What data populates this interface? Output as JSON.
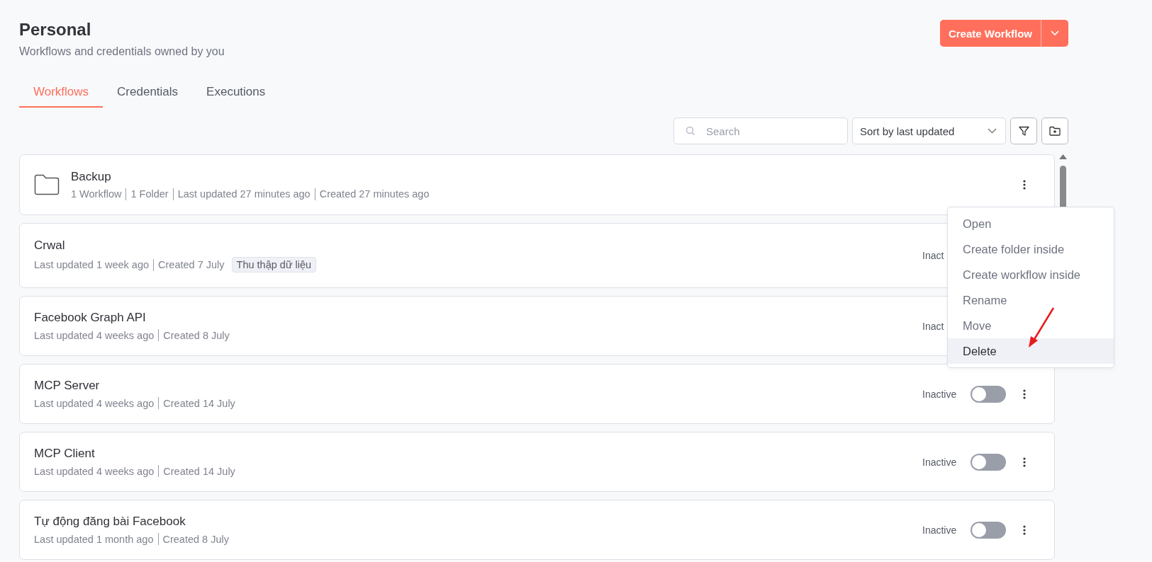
{
  "header": {
    "title": "Personal",
    "subtitle": "Workflows and credentials owned by you",
    "create_button": "Create Workflow"
  },
  "tabs": [
    {
      "label": "Workflows",
      "selected": true
    },
    {
      "label": "Credentials",
      "selected": false
    },
    {
      "label": "Executions",
      "selected": false
    }
  ],
  "search": {
    "placeholder": "Search"
  },
  "sort": {
    "value": "Sort by last updated"
  },
  "items": [
    {
      "kind": "folder",
      "name": "Backup",
      "meta": [
        "1 Workflow",
        "1 Folder",
        "Last updated 27 minutes ago",
        "Created 27 minutes ago"
      ]
    },
    {
      "kind": "workflow",
      "name": "Crwal",
      "meta": [
        "Last updated 1 week ago",
        "Created 7 July"
      ],
      "tags": [
        "Thu thập dữ liệu"
      ],
      "status": "Inact"
    },
    {
      "kind": "workflow",
      "name": "Facebook Graph API",
      "meta": [
        "Last updated 4 weeks ago",
        "Created 8 July"
      ],
      "status": "Inact"
    },
    {
      "kind": "workflow",
      "name": "MCP Server",
      "meta": [
        "Last updated 4 weeks ago",
        "Created 14 July"
      ],
      "status": "Inactive",
      "active": false
    },
    {
      "kind": "workflow",
      "name": "MCP Client",
      "meta": [
        "Last updated 4 weeks ago",
        "Created 14 July"
      ],
      "status": "Inactive",
      "active": false
    },
    {
      "kind": "workflow",
      "name": "Tự động đăng bài Facebook",
      "meta": [
        "Last updated 1 month ago",
        "Created 8 July"
      ],
      "status": "Inactive",
      "active": false
    }
  ],
  "menu": [
    {
      "label": "Open",
      "selected": false
    },
    {
      "label": "Create folder inside",
      "selected": false
    },
    {
      "label": "Create workflow inside",
      "selected": false
    },
    {
      "label": "Rename",
      "selected": false
    },
    {
      "label": "Move",
      "selected": false
    },
    {
      "label": "Delete",
      "selected": true
    }
  ]
}
